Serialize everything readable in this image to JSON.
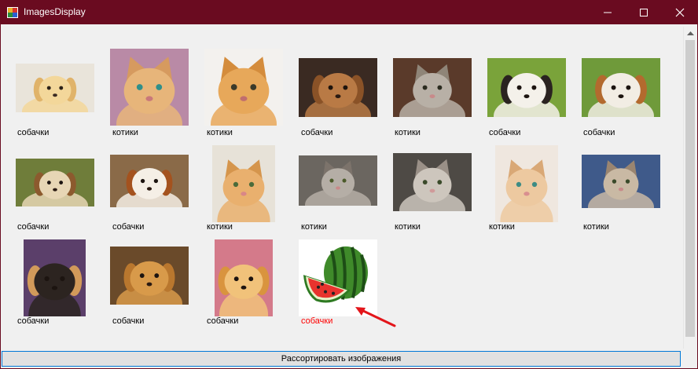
{
  "window": {
    "title": "ImagesDisplay"
  },
  "gallery": {
    "items": [
      {
        "caption": "собачки",
        "subject": "dog"
      },
      {
        "caption": "котики",
        "subject": "cat"
      },
      {
        "caption": "котики",
        "subject": "cat"
      },
      {
        "caption": "собачки",
        "subject": "dog"
      },
      {
        "caption": "котики",
        "subject": "cat"
      },
      {
        "caption": "собачки",
        "subject": "dog"
      },
      {
        "caption": "собачки",
        "subject": "dog"
      },
      {
        "caption": "собачки",
        "subject": "dog"
      },
      {
        "caption": "собачки",
        "subject": "dog"
      },
      {
        "caption": "котики",
        "subject": "cat"
      },
      {
        "caption": "котики",
        "subject": "cat"
      },
      {
        "caption": "котики",
        "subject": "cat"
      },
      {
        "caption": "котики",
        "subject": "cat"
      },
      {
        "caption": "котики",
        "subject": "cat"
      },
      {
        "caption": "собачки",
        "subject": "dog"
      },
      {
        "caption": "собачки",
        "subject": "dog"
      },
      {
        "caption": "собачки",
        "subject": "dog"
      },
      {
        "caption": "собачки",
        "subject": "watermelon",
        "highlight": "#ff0000"
      }
    ]
  },
  "actions": {
    "sort_label": "Рассортировать изображения"
  },
  "colors": {
    "titlebar": "#6a0b20",
    "button_border": "#0078d7",
    "highlight_caption": "#ff0000",
    "annotation_arrow": "#e3151a"
  }
}
